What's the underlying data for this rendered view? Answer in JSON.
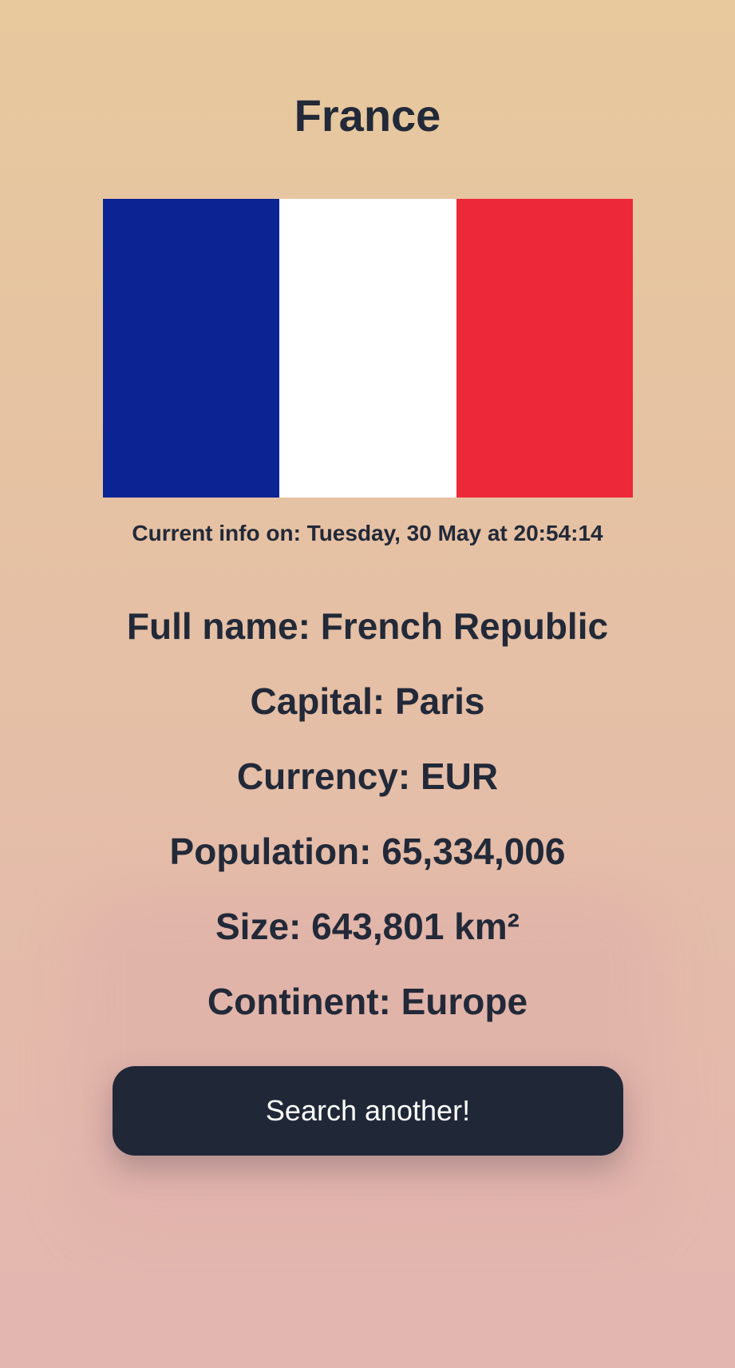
{
  "country": {
    "name": "France"
  },
  "flag": {
    "colors": [
      "#0c2393",
      "#ffffff",
      "#ed2939"
    ]
  },
  "timestamp": "Current info on: Tuesday, 30 May at 20:54:14",
  "facts": [
    "Full name: French Republic",
    "Capital: Paris",
    "Currency: EUR",
    "Population: 65,334,006",
    "Size: 643,801 km²",
    "Continent: Europe"
  ],
  "actions": {
    "search_label": "Search another!"
  },
  "colors": {
    "text": "#222938",
    "button_bg": "#202838",
    "button_text": "#ffffff"
  }
}
